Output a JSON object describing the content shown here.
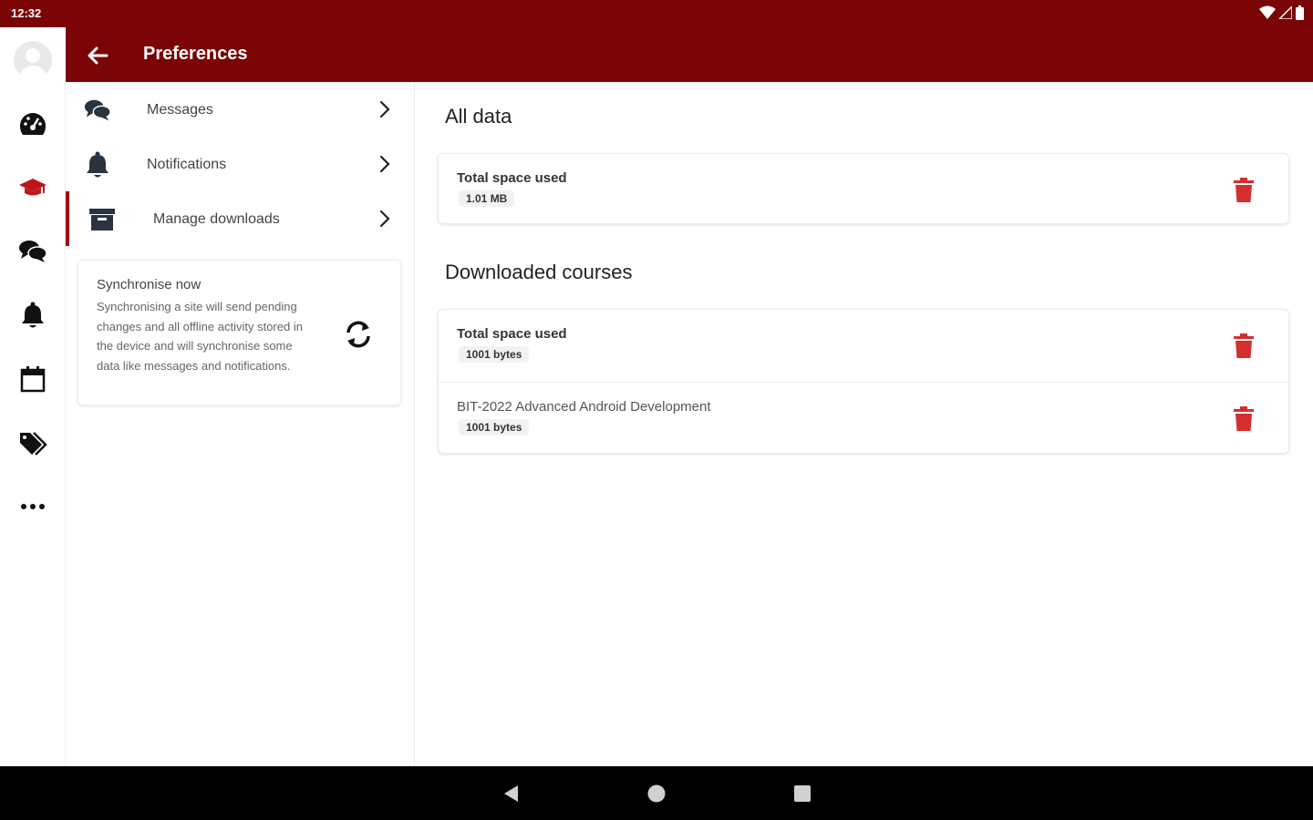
{
  "status_bar": {
    "time": "12:32"
  },
  "header": {
    "title": "Preferences"
  },
  "rail": {
    "items": [
      {
        "name": "dashboard",
        "icon": "dashboard-icon"
      },
      {
        "name": "my-courses",
        "icon": "graduation-cap-icon",
        "active": true
      },
      {
        "name": "messages",
        "icon": "chat-icon"
      },
      {
        "name": "notifications",
        "icon": "bell-icon"
      },
      {
        "name": "calendar",
        "icon": "calendar-icon"
      },
      {
        "name": "tags",
        "icon": "tags-icon"
      },
      {
        "name": "more",
        "icon": "ellipsis-icon"
      }
    ]
  },
  "menu": {
    "items": [
      {
        "label": "Messages",
        "icon": "chat-icon"
      },
      {
        "label": "Notifications",
        "icon": "bell-icon"
      },
      {
        "label": "Manage downloads",
        "icon": "archive-icon",
        "active": true
      }
    ]
  },
  "sync": {
    "title": "Synchronise now",
    "description": "Synchronising a site will send pending changes and all offline activity stored in the device and will synchronise some data like messages and notifications."
  },
  "content": {
    "all_data": {
      "heading": "All data",
      "rows": [
        {
          "title": "Total space used",
          "value": "1.01 MB"
        }
      ]
    },
    "downloaded_courses": {
      "heading": "Downloaded courses",
      "rows": [
        {
          "title": "Total space used",
          "value": "1001 bytes"
        },
        {
          "title": "BIT-2022 Advanced Android Development",
          "value": "1001 bytes"
        }
      ]
    }
  },
  "colors": {
    "brand": "#7a0406",
    "accent": "#a3070b",
    "delete": "#d32f2f"
  }
}
